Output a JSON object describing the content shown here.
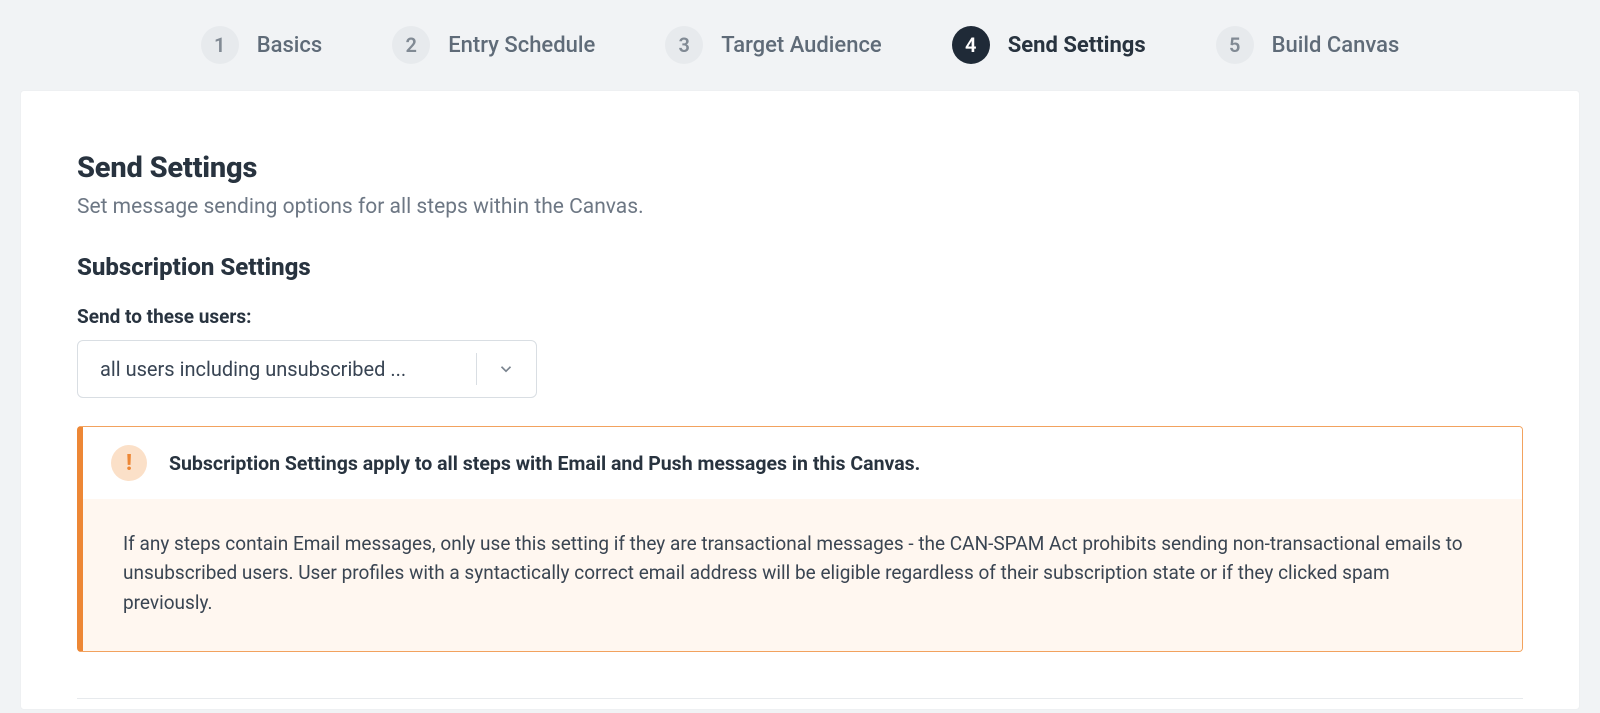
{
  "stepper": {
    "steps": [
      {
        "num": "1",
        "label": "Basics",
        "active": false
      },
      {
        "num": "2",
        "label": "Entry Schedule",
        "active": false
      },
      {
        "num": "3",
        "label": "Target Audience",
        "active": false
      },
      {
        "num": "4",
        "label": "Send Settings",
        "active": true
      },
      {
        "num": "5",
        "label": "Build Canvas",
        "active": false
      }
    ]
  },
  "page": {
    "title": "Send Settings",
    "description": "Set message sending options for all steps within the Canvas."
  },
  "subscription": {
    "section_title": "Subscription Settings",
    "field_label": "Send to these users:",
    "select_value": "all users including unsubscribed ..."
  },
  "alert": {
    "icon_glyph": "!",
    "title": "Subscription Settings apply to all steps with Email and Push messages in this Canvas.",
    "body": "If any steps contain Email messages, only use this setting if they are transactional messages - the CAN-SPAM Act prohibits sending non-transactional emails to unsubscribed users. User profiles with a syntactically correct email address will be eligible regardless of their subscription state or if they clicked spam previously."
  }
}
